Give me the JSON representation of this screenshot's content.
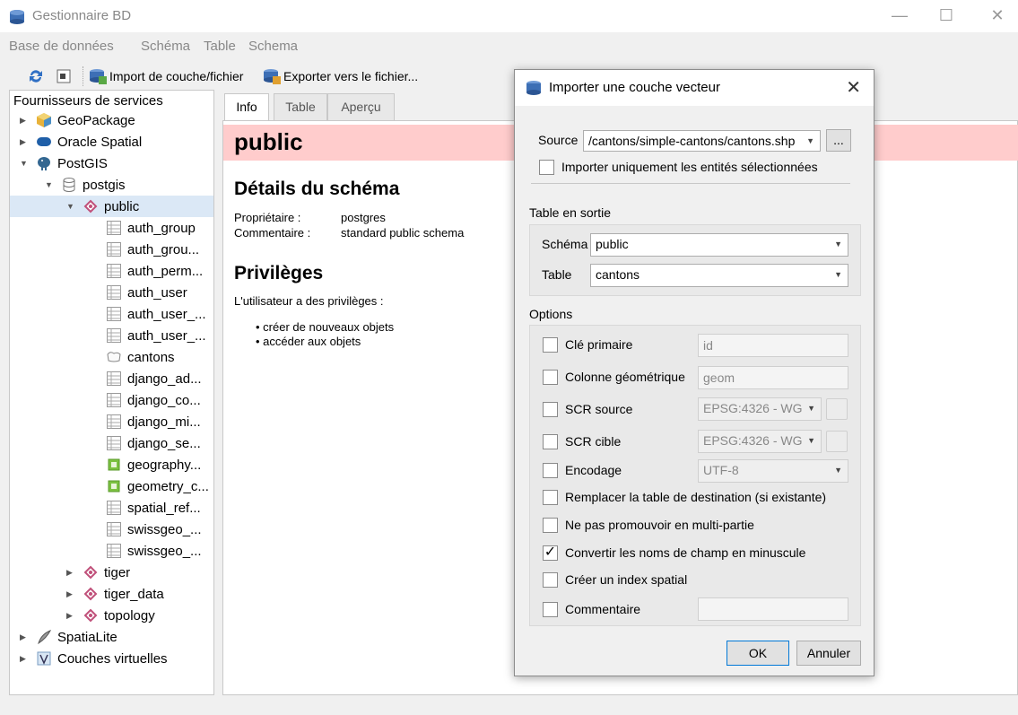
{
  "window": {
    "title": "Gestionnaire BD",
    "controls": {
      "minimize": "—",
      "maximize": "☐",
      "close": "✕"
    }
  },
  "menubar": [
    "Base de données",
    "Schéma",
    "Table",
    "Schema"
  ],
  "toolbar": {
    "import_label": "Import de couche/fichier",
    "export_label": "Exporter vers le fichier..."
  },
  "providers": {
    "header": "Fournisseurs de services",
    "items": [
      {
        "label": "GeoPackage",
        "icon": "geopackage-icon"
      },
      {
        "label": "Oracle Spatial",
        "icon": "oracle-icon"
      },
      {
        "label": "PostGIS",
        "icon": "postgis-elephant-icon"
      },
      {
        "label": "postgis",
        "icon": "database-icon"
      },
      {
        "label": "public",
        "icon": "schema-icon"
      },
      {
        "label": "auth_group",
        "icon": "table-icon"
      },
      {
        "label": "auth_grou...",
        "icon": "table-icon"
      },
      {
        "label": "auth_perm...",
        "icon": "table-icon"
      },
      {
        "label": "auth_user",
        "icon": "table-icon"
      },
      {
        "label": "auth_user_...",
        "icon": "table-icon"
      },
      {
        "label": "auth_user_...",
        "icon": "table-icon"
      },
      {
        "label": "cantons",
        "icon": "polygon-layer-icon"
      },
      {
        "label": "django_ad...",
        "icon": "table-icon"
      },
      {
        "label": "django_co...",
        "icon": "table-icon"
      },
      {
        "label": "django_mi...",
        "icon": "table-icon"
      },
      {
        "label": "django_se...",
        "icon": "table-icon"
      },
      {
        "label": "geography...",
        "icon": "view-icon"
      },
      {
        "label": "geometry_c...",
        "icon": "view-icon"
      },
      {
        "label": "spatial_ref...",
        "icon": "table-icon"
      },
      {
        "label": "swissgeo_...",
        "icon": "table-icon"
      },
      {
        "label": "swissgeo_...",
        "icon": "table-icon"
      },
      {
        "label": "tiger",
        "icon": "schema-icon"
      },
      {
        "label": "tiger_data",
        "icon": "schema-icon"
      },
      {
        "label": "topology",
        "icon": "schema-icon"
      },
      {
        "label": "SpatiaLite",
        "icon": "spatialite-feather-icon"
      },
      {
        "label": "Couches virtuelles",
        "icon": "virtual-layer-icon"
      }
    ]
  },
  "tabs": [
    "Info",
    "Table",
    "Aperçu"
  ],
  "info": {
    "schema_name": "public",
    "details_title": "Détails du schéma",
    "owner_label": "Propriétaire :",
    "owner_value": "postgres",
    "comment_label": "Commentaire :",
    "comment_value": "standard public schema",
    "privileges_title": "Privilèges",
    "privileges_intro": "L'utilisateur a des privilèges :",
    "privileges": [
      "• créer de nouveaux objets",
      "• accéder aux objets"
    ]
  },
  "dialog": {
    "title": "Importer une couche vecteur",
    "close": "✕",
    "source_label": "Source",
    "source_value": "/cantons/simple-cantons/cantons.shp",
    "browse_label": "...",
    "selected_only_label": "Importer uniquement les entités sélectionnées",
    "output_group": "Table en sortie",
    "schema_label": "Schéma",
    "schema_value": "public",
    "table_label": "Table",
    "table_value": "cantons",
    "options_group": "Options",
    "options": {
      "pk_label": "Clé primaire",
      "pk_value": "id",
      "geom_label": "Colonne géométrique",
      "geom_value": "geom",
      "src_crs_label": "SCR source",
      "src_crs_value": "EPSG:4326 - WG",
      "dst_crs_label": "SCR cible",
      "dst_crs_value": "EPSG:4326 - WG",
      "encoding_label": "Encodage",
      "encoding_value": "UTF-8",
      "replace_label": "Remplacer la table de destination (si existante)",
      "no_multi_label": "Ne pas promouvoir en multi-partie",
      "lowercase_label": "Convertir les noms de champ en minuscule",
      "spatial_index_label": "Créer un index spatial",
      "comment_label": "Commentaire"
    },
    "checkbox_states": {
      "lowercase": true
    },
    "check_mark": "✓",
    "ok_label": "OK",
    "cancel_label": "Annuler"
  }
}
